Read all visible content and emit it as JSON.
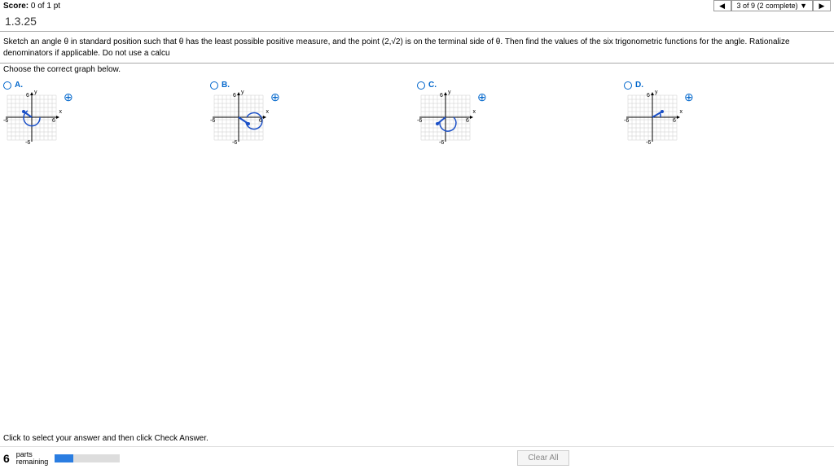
{
  "topbar": {
    "score_label": "Score:",
    "score_value": "0 of 1 pt",
    "nav_prev": "◀",
    "nav_status": "3 of 9 (2 complete) ▼",
    "nav_next": "▶"
  },
  "question": {
    "number": "1.3.25",
    "text_part1": "Sketch an angle θ in standard position such that θ has the least possible positive measure, and the point ",
    "point": "(2,√2)",
    "text_part2": " is on the terminal side of θ. Then find the values of the six trigonometric functions for the angle. Rationalize denominators if applicable. Do not use a calcu",
    "choose_label": "Choose the correct graph below."
  },
  "options": {
    "a": {
      "label": "A."
    },
    "b": {
      "label": "B."
    },
    "c": {
      "label": "C."
    },
    "d": {
      "label": "D."
    }
  },
  "graph": {
    "y_label": "y",
    "x_label": "x",
    "max": "6",
    "neg_max": "-6"
  },
  "icons": {
    "zoom": "⊕"
  },
  "footer": {
    "instruction": "Click to select your answer and then click Check Answer.",
    "parts_num": "6",
    "parts_label": "parts\nremaining",
    "clear_all": "Clear All"
  }
}
